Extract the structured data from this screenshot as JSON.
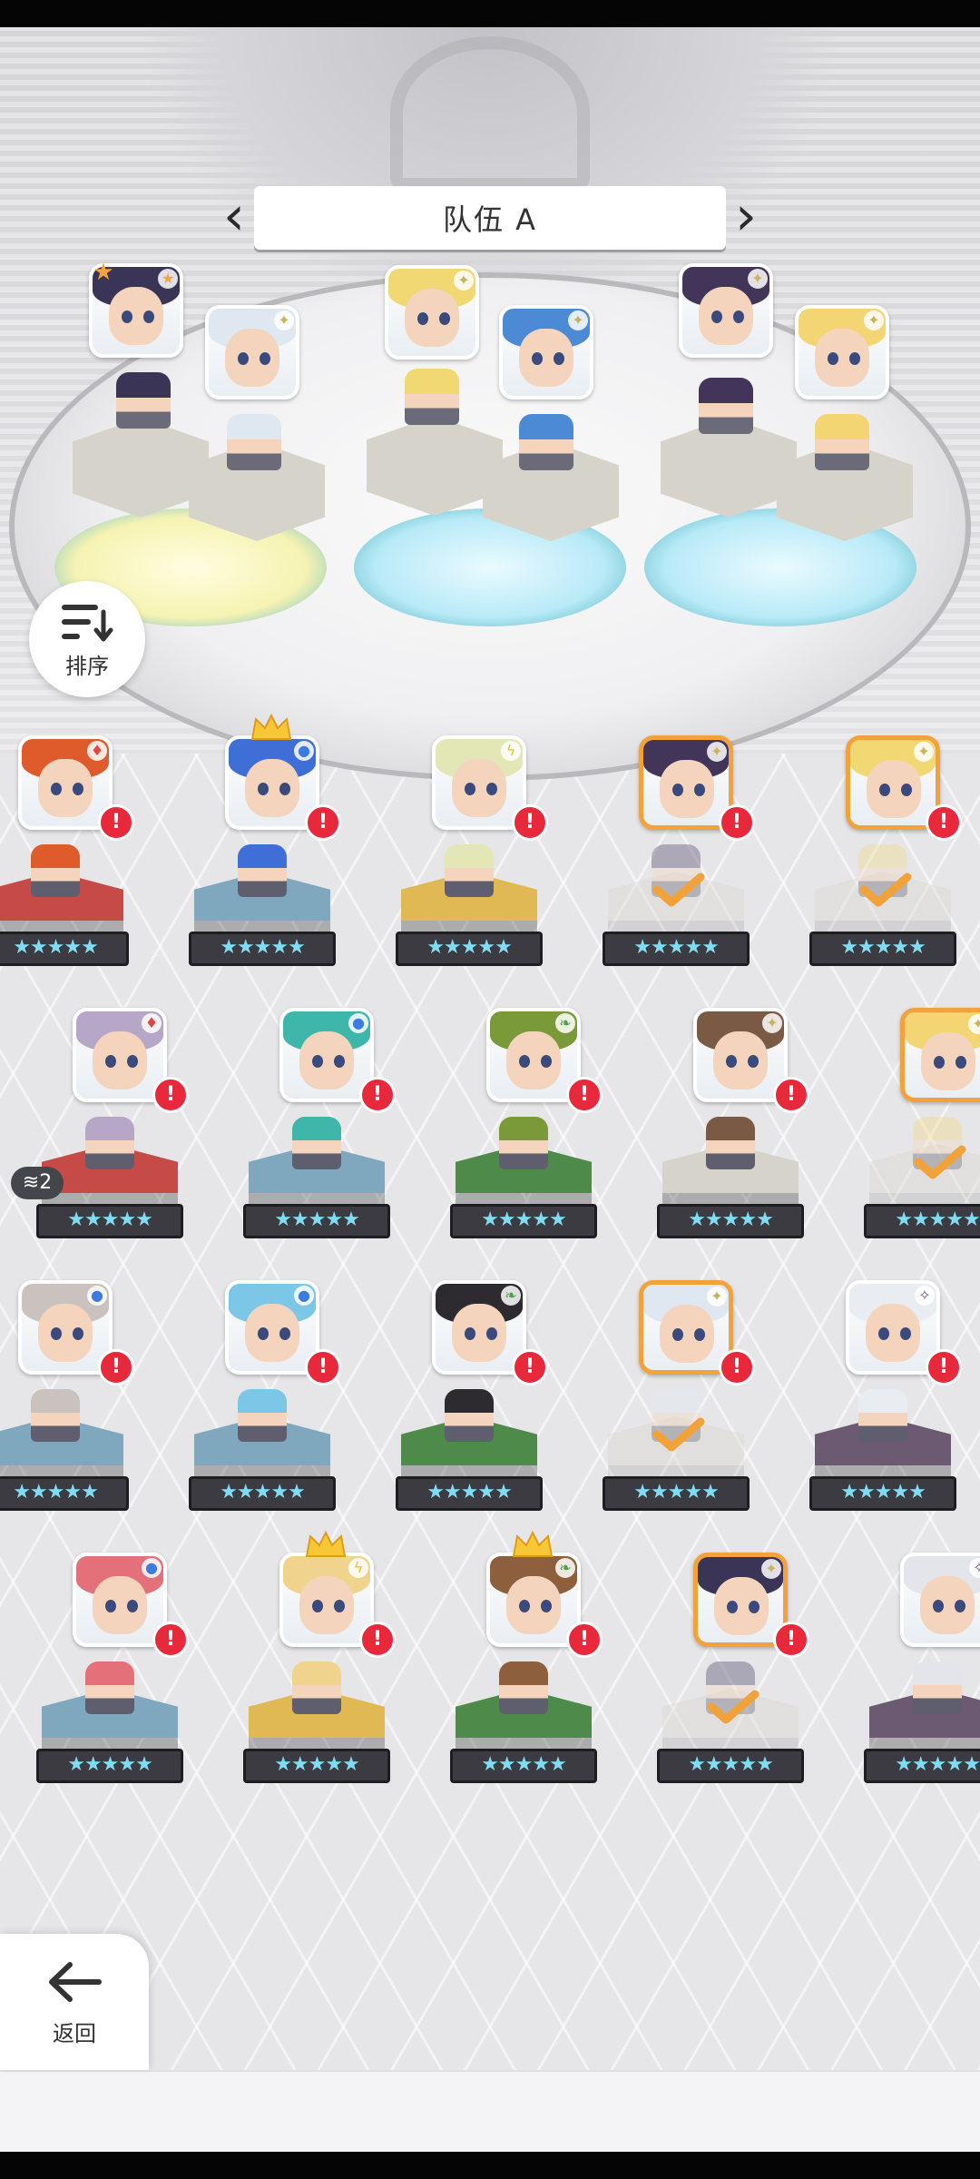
{
  "team": {
    "title": "队伍 A",
    "prev_glyph": "‹",
    "next_glyph": "›"
  },
  "controls": {
    "sort_label": "排序",
    "back_label": "返回"
  },
  "stage_badge": {
    "count": "2"
  },
  "colors": {
    "alert": "#e8283b",
    "selected_border": "#f2a23a",
    "star_strip": "#3b3b41",
    "stand_red": "#c64a45",
    "stand_blue": "#7fa7bd",
    "stand_yellow": "#e1b954",
    "stand_green": "#4e8b4a",
    "stand_white": "#d6d3cb",
    "stand_purple": "#6b5a72"
  },
  "team_slots": [
    {
      "name": "dark-hair-girl",
      "hair": "#3a3456",
      "element": "star-icon"
    },
    {
      "name": "white-hair-girl",
      "hair": "#dfe8f0",
      "element": "sparkle-icon"
    },
    {
      "name": "blonde-cap-girl",
      "hair": "#f2d873",
      "element": "sparkle-icon"
    },
    {
      "name": "blue-hair-boy",
      "hair": "#4d8ad6",
      "element": "sparkle-icon"
    },
    {
      "name": "dark-skin-girl",
      "hair": "#43345a",
      "element": "sparkle-icon"
    },
    {
      "name": "blonde-girl",
      "hair": "#f3d673",
      "element": "sparkle-icon"
    }
  ],
  "roster": [
    {
      "hair": "#e05b2c",
      "element": "diamond-icon",
      "alert": "!",
      "selected": false,
      "stand": "red"
    },
    {
      "hair": "#3f6fd6",
      "element": "water-icon",
      "alert": "!",
      "selected": false,
      "stand": "blue",
      "crown": true
    },
    {
      "hair": "#e3e7b6",
      "element": "lightning-icon",
      "alert": "!",
      "selected": false,
      "stand": "yellow"
    },
    {
      "hair": "#43345a",
      "element": "sparkle-icon",
      "alert": "!",
      "selected": true,
      "stand": "white",
      "done": true
    },
    {
      "hair": "#f2d873",
      "element": "sparkle-icon",
      "alert": "!",
      "selected": true,
      "stand": "white",
      "done": true
    },
    {
      "hair": "#b6a7c9",
      "element": "diamond-icon",
      "alert": "!",
      "selected": false,
      "stand": "red"
    },
    {
      "hair": "#3fb6aa",
      "element": "water-icon",
      "alert": "!",
      "selected": false,
      "stand": "blue"
    },
    {
      "hair": "#7a9a3a",
      "element": "leaf-icon",
      "alert": "!",
      "selected": false,
      "stand": "green"
    },
    {
      "hair": "#7a5a45",
      "element": "sparkle-icon",
      "alert": "!",
      "selected": false,
      "stand": "white"
    },
    {
      "hair": "#f3d673",
      "element": "sparkle-icon",
      "alert": "!",
      "selected": true,
      "stand": "white",
      "done": true
    },
    {
      "hair": "#c9c2be",
      "element": "water-icon",
      "alert": "!",
      "selected": false,
      "stand": "blue"
    },
    {
      "hair": "#7cc6e8",
      "element": "water-icon",
      "alert": "!",
      "selected": false,
      "stand": "blue"
    },
    {
      "hair": "#2d2b30",
      "element": "leaf-icon",
      "alert": "!",
      "selected": false,
      "stand": "green"
    },
    {
      "hair": "#dfe8f0",
      "element": "sparkle-icon",
      "alert": "!",
      "selected": true,
      "stand": "white",
      "done": true
    },
    {
      "hair": "#e9edf2",
      "element": "dark-icon",
      "alert": "!",
      "selected": false,
      "stand": "purple"
    },
    {
      "hair": "#e4707a",
      "element": "water-icon",
      "alert": "!",
      "selected": false,
      "stand": "blue"
    },
    {
      "hair": "#f0d48e",
      "element": "lightning-icon",
      "alert": "!",
      "selected": false,
      "stand": "yellow",
      "crown": true
    },
    {
      "hair": "#8d5f3c",
      "element": "leaf-icon",
      "alert": "!",
      "selected": false,
      "stand": "green",
      "crown": true
    },
    {
      "hair": "#3a3456",
      "element": "sparkle-icon",
      "alert": "!",
      "selected": true,
      "stand": "white",
      "done": true
    },
    {
      "hair": "#e3e5ea",
      "element": "dark-icon",
      "alert": "!",
      "selected": false,
      "stand": "purple"
    }
  ],
  "star_rating": "★★★★★"
}
